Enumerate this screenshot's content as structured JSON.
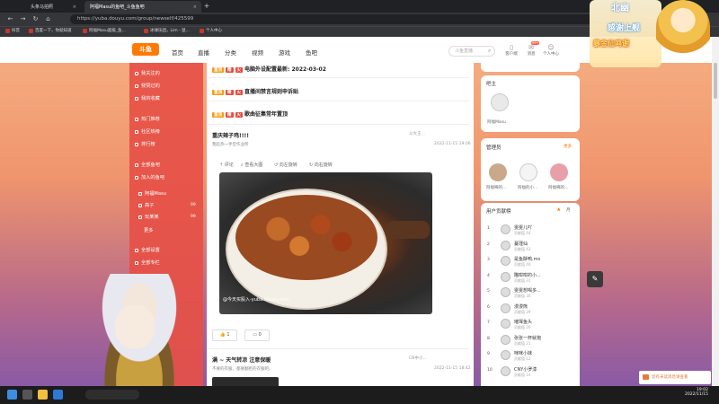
{
  "browser": {
    "tabs": [
      {
        "label": "头条马拍照"
      },
      {
        "label": "阿福Masu的鱼吧_斗鱼鱼吧"
      }
    ],
    "url": "https://yuba.douyu.com/group/newself/425599",
    "bookmarks": [
      "抖音",
      "百度一下，你就知道",
      "阿福Masu超级_鱼...",
      "冰球乐团，Lim - 鼠...",
      "个人中心"
    ]
  },
  "site": {
    "logo": "斗鱼",
    "nav": [
      "首页",
      "直播",
      "分类",
      "视频",
      "游戏",
      "鱼吧"
    ],
    "search_placeholder": "斗鱼直播",
    "header_icons": [
      {
        "label": "客户端",
        "icon": "phone-icon"
      },
      {
        "label": "消息",
        "icon": "bell-icon"
      },
      {
        "label": "个人中心",
        "icon": "user-icon"
      }
    ],
    "msg_badge": "99+"
  },
  "sidebar": {
    "items": [
      "我关注的",
      "我赞过的",
      "我的收藏",
      "热门推荐",
      "社区热榜",
      "排行榜",
      "全部鱼吧",
      "加入的鱼吧",
      "阿福Masu",
      "高子",
      "玩某某",
      "更多",
      "全部设置",
      "全部专栏"
    ],
    "counts": [
      "99",
      "99"
    ]
  },
  "feed": {
    "pinned": [
      {
        "b1": "置顶",
        "b2": "精",
        "b3": "火",
        "title": "电脑外设配置最新: 2022-03-02"
      },
      {
        "b1": "置顶",
        "b2": "精",
        "b3": "火",
        "title": "直播间禁言规则申诉贴"
      },
      {
        "b1": "置顶",
        "b2": "精",
        "b3": "火",
        "title": "歌曲征集常年置顶"
      }
    ],
    "post1": {
      "title": "重庆辣子鸡!!!!",
      "sub": "我趁热一手空作业所",
      "author": "斗大王...",
      "date": "2022-11-15 19:06",
      "tools": [
        "评论",
        "查看大图",
        "向左旋转",
        "向右旋转"
      ],
      "watermark": "@今天买股入-yuba.douyu.com",
      "likes": "1",
      "comments": "0"
    },
    "post2": {
      "title": "满 ~ 天气转凉 注意保暖",
      "sub": "不要的衣服，都要翻柜的衣服吧。",
      "author": "CN中小...",
      "date": "2022-11-15 18:42"
    }
  },
  "right": {
    "owner_title": "吧主",
    "owner_name": "阿福Masu",
    "admin_title": "管理员",
    "admin_link": "更多",
    "admins": [
      "阿福嘀的...",
      "阿福的小...",
      "阿福嘀的..."
    ],
    "rank_title": "用户贡献榜",
    "rank_tab": "月",
    "ranks": [
      {
        "no": "1",
        "name": "雯雯儿吖",
        "sub": "贡献值 44"
      },
      {
        "no": "2",
        "name": "蔓瑾仙",
        "sub": "贡献值 43"
      },
      {
        "no": "3",
        "name": "是鱼酥鸭.ms",
        "sub": "贡献值 40"
      },
      {
        "no": "4",
        "name": "瞄咁咁的小...",
        "sub": "贡献值 31"
      },
      {
        "no": "5",
        "name": "雯雯想喝多...",
        "sub": "贡献值 30"
      },
      {
        "no": "6",
        "name": "漫漫熊",
        "sub": "贡献值 29"
      },
      {
        "no": "7",
        "name": "璀璨鱼头",
        "sub": "贡献值 26"
      },
      {
        "no": "8",
        "name": "张张一杯就抱",
        "sub": "贡献值 21"
      },
      {
        "no": "9",
        "name": "咪咪小妹",
        "sub": "贡献值 12"
      },
      {
        "no": "10",
        "name": "CNY小罗漆",
        "sub": "贡献值 10"
      }
    ]
  },
  "notice": "您有未读消息请查看",
  "overlay": {
    "name": "北幽",
    "line1": "感谢上舰",
    "line2": "暴金仙鸣谢"
  },
  "taskbar": {
    "time": "19:02",
    "date": "2022/11/15"
  }
}
